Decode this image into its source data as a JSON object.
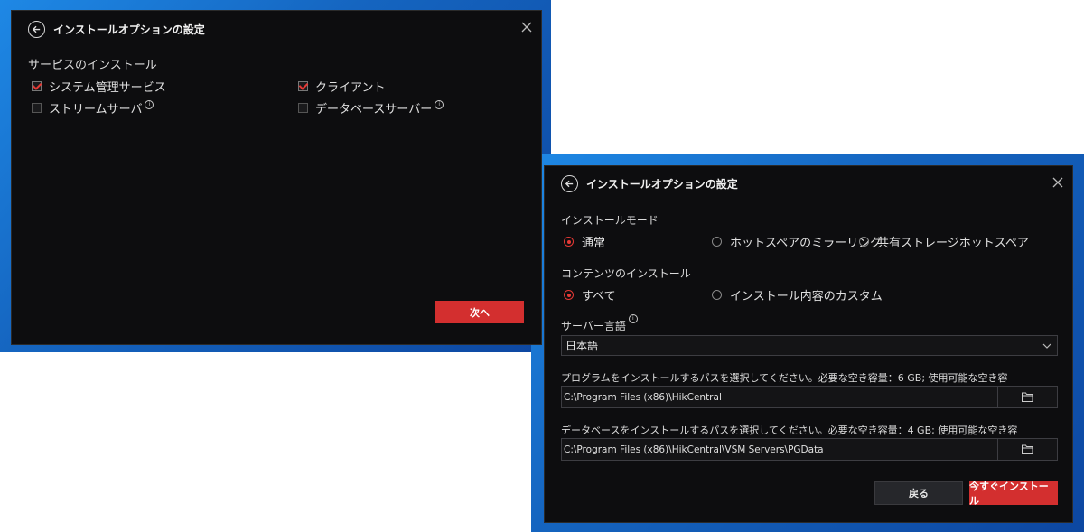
{
  "dialog1": {
    "title": "インストールオプションの設定",
    "section_label": "サービスのインストール",
    "options": [
      {
        "label": "システム管理サービス",
        "checked": true
      },
      {
        "label": "クライアント",
        "checked": true
      },
      {
        "label": "ストリームサーバ",
        "checked": false,
        "info": true
      },
      {
        "label": "データベースサーバー",
        "checked": false,
        "info": true
      }
    ],
    "next_button": "次へ"
  },
  "dialog2": {
    "title": "インストールオプションの設定",
    "install_mode_label": "インストールモード",
    "install_modes": [
      {
        "label": "通常",
        "checked": true
      },
      {
        "label": "ホットスペアのミラーリング",
        "checked": false
      },
      {
        "label": "共有ストレージホットスペア",
        "checked": false
      }
    ],
    "content_label": "コンテンツのインストール",
    "content_options": [
      {
        "label": "すべて",
        "checked": true
      },
      {
        "label": "インストール内容のカスタム",
        "checked": false
      }
    ],
    "server_language_label": "サーバー言語",
    "server_language_value": "日本語",
    "program_path_label": "プログラムをインストールするパスを選択してください。必要な空き容量：6 GB; 使用可能な空き容",
    "program_path_value": "C:\\Program Files (x86)\\HikCentral",
    "database_path_label": "データベースをインストールするパスを選択してください。必要な空き容量：4 GB; 使用可能な空き容",
    "database_path_value": "C:\\Program Files (x86)\\HikCentral\\VSM Servers\\PGData",
    "back_button": "戻る",
    "install_button": "今すぐインストール"
  },
  "colors": {
    "accent": "#d32f2f",
    "dialog_bg": "#0d0d0f",
    "desktop_blue": "#1565c0"
  }
}
